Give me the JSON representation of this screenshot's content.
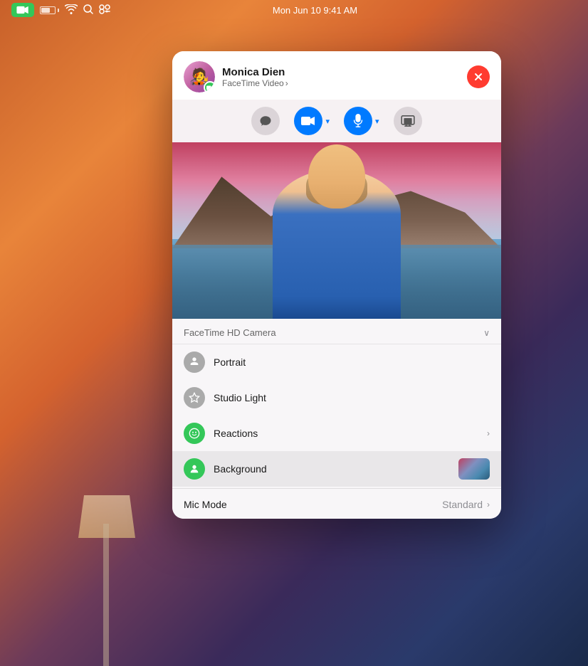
{
  "desktop": {
    "background": "macOS gradient wallpaper"
  },
  "menubar": {
    "time": "Mon Jun 10  9:41 AM",
    "app_icon": "facetime-icon",
    "battery": "battery-icon",
    "wifi": "wifi-icon",
    "search": "search-icon",
    "control_center": "control-center-icon"
  },
  "facetime_window": {
    "contact_name": "Monica Dien",
    "contact_type": "FaceTime Video",
    "chevron": ">",
    "close_label": "×",
    "controls": {
      "message_icon": "message-icon",
      "video_icon": "video-icon",
      "video_chevron": "▾",
      "mic_icon": "mic-icon",
      "mic_chevron": "▾",
      "screen_share_icon": "screen-share-icon"
    }
  },
  "camera_menu": {
    "camera_title": "FaceTime HD Camera",
    "chevron": "✓",
    "items": [
      {
        "id": "portrait",
        "label": "Portrait",
        "icon_type": "gray",
        "icon_char": "ƒ",
        "has_chevron": false,
        "has_thumbnail": false,
        "active": false
      },
      {
        "id": "studio_light",
        "label": "Studio Light",
        "icon_type": "gray",
        "icon_char": "⬡",
        "has_chevron": false,
        "has_thumbnail": false,
        "active": false
      },
      {
        "id": "reactions",
        "label": "Reactions",
        "icon_type": "green",
        "icon_char": "⊕",
        "has_chevron": true,
        "has_thumbnail": false,
        "active": false
      },
      {
        "id": "background",
        "label": "Background",
        "icon_type": "green",
        "icon_char": "👤",
        "has_chevron": false,
        "has_thumbnail": true,
        "active": true
      }
    ],
    "mic_mode": {
      "label": "Mic Mode",
      "value": "Standard",
      "has_chevron": true
    }
  }
}
